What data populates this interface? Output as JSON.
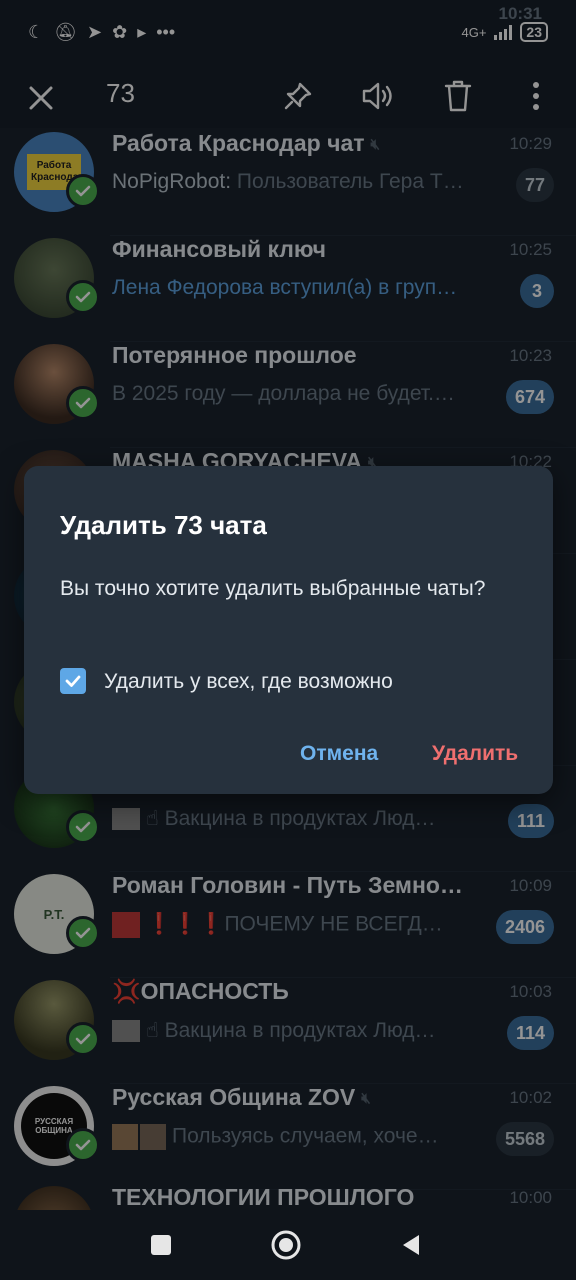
{
  "status_bar": {
    "time": "10:31",
    "network": "4G+",
    "battery": "23",
    "icons": [
      "moon-icon",
      "mute-bell-icon",
      "telegram-icon",
      "paw-icon",
      "play-icon",
      "more-dots-icon"
    ]
  },
  "action_bar": {
    "selected_count": "73",
    "icons": [
      "close-icon",
      "pin-icon",
      "unmute-icon",
      "trash-icon",
      "more-vert-icon"
    ]
  },
  "chats": [
    {
      "title": "Работа Краснодар чат",
      "muted": true,
      "time": "10:29",
      "sender": "NoPigRobot:",
      "preview": " Пользователь Гера Т…",
      "badge": "77",
      "badge_muted": true,
      "avatar_text": "Работа Краснодар"
    },
    {
      "title": "Финансовый ключ",
      "muted": false,
      "time": "10:25",
      "sender": "",
      "preview": "Лена Федорова вступил(а) в груп…",
      "preview_blue": true,
      "badge": "3",
      "badge_muted": false,
      "avatar_text": ""
    },
    {
      "title": "Потерянное прошлое",
      "muted": false,
      "time": "10:23",
      "sender": "",
      "preview": "В 2025 году — доллара не будет.…",
      "badge": "674",
      "badge_muted": false,
      "avatar_text": ""
    },
    {
      "title": "MASHA GORYACHEVA",
      "muted": true,
      "time": "10:22",
      "sender": "",
      "preview": "",
      "badge": "",
      "badge_muted": false,
      "avatar_text": ""
    },
    {
      "title": "",
      "muted": false,
      "time": "",
      "sender": "",
      "preview": "☝ Вакцина в продуктах  Люд…",
      "badge": "111",
      "badge_muted": false,
      "avatar_text": ""
    },
    {
      "title": "Роман Головин - Путь Земно…",
      "muted": false,
      "time": "10:09",
      "sender": "",
      "preview": "❗❗❗ПОЧЕМУ НЕ ВСЕГД…",
      "badge": "2406",
      "badge_muted": false,
      "avatar_text": "P.T."
    },
    {
      "title": "💢ОПАСНОСТЬ",
      "muted": false,
      "time": "10:03",
      "sender": "",
      "preview": "☝ Вакцина в продуктах  Люд…",
      "badge": "114",
      "badge_muted": false,
      "avatar_text": ""
    },
    {
      "title": "Русская Община ZOV",
      "muted": true,
      "time": "10:02",
      "sender": "",
      "preview": "Пользуясь случаем, хоче…",
      "badge": "5568",
      "badge_muted": true,
      "avatar_text": "РУССКАЯ ОБЩИНА"
    },
    {
      "title": "ТЕХНОЛОГИИ ПРОШЛОГО",
      "muted": false,
      "time": "10:00",
      "sender": "",
      "preview": "",
      "badge": "",
      "badge_muted": false,
      "avatar_text": ""
    }
  ],
  "dialog": {
    "title": "Удалить 73 чата",
    "message": "Вы точно хотите удалить выбранные чаты?",
    "checkbox_label": "Удалить у всех, где возможно",
    "checkbox_checked": true,
    "cancel_label": "Отмена",
    "delete_label": "Удалить"
  },
  "nav_bar": {
    "icons": [
      "recents-square-icon",
      "home-circle-icon",
      "back-triangle-icon"
    ]
  },
  "colors": {
    "background": "#1b232e",
    "dialog": "#26313d",
    "accent_blue": "#6fb3ee",
    "danger_red": "#ef6f6f",
    "check_green": "#4cb050"
  }
}
